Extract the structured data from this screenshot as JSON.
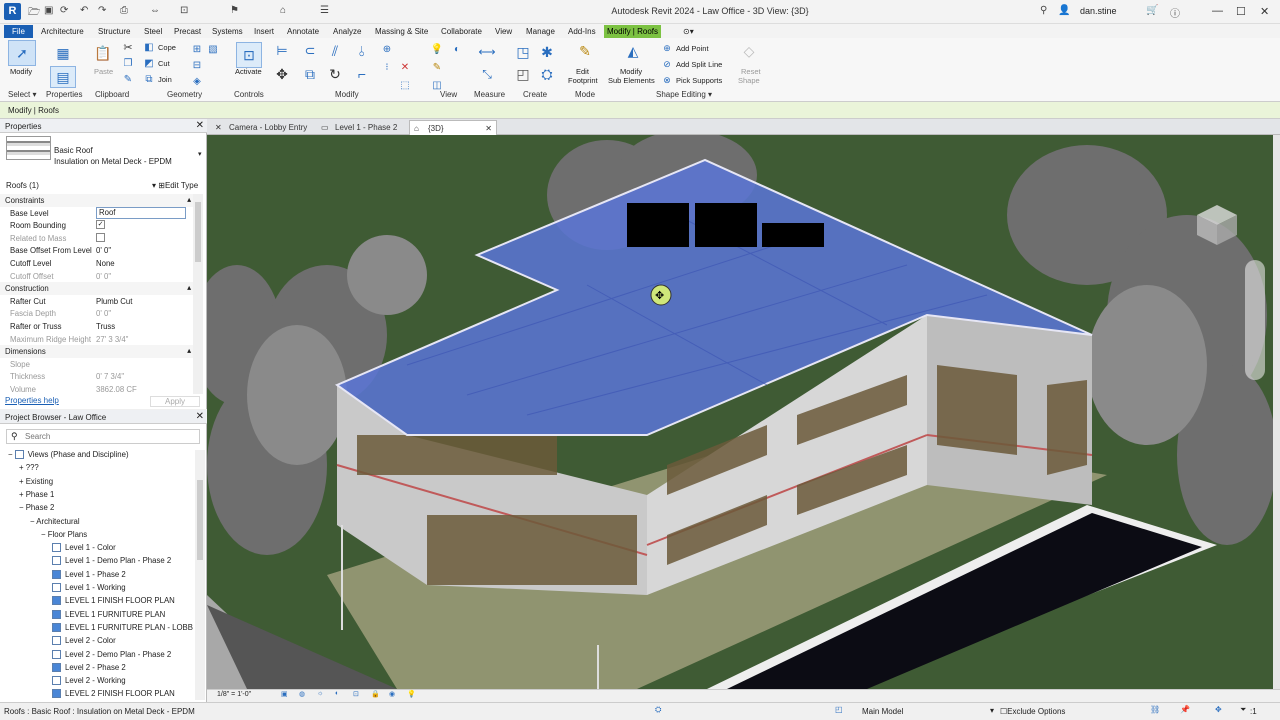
{
  "app": {
    "icon_letter": "R",
    "title": "Autodesk Revit 2024 - Law Office - 3D View: {3D}",
    "user": "dan.stine"
  },
  "ribbon_tabs": [
    "File",
    "Architecture",
    "Structure",
    "Steel",
    "Precast",
    "Systems",
    "Insert",
    "Annotate",
    "Analyze",
    "Massing & Site",
    "Collaborate",
    "View",
    "Manage",
    "Add-Ins",
    "Modify | Roofs"
  ],
  "ribbon": {
    "modify": "Modify",
    "paste": "Paste",
    "cope": "Cope",
    "cut": "Cut",
    "join": "Join",
    "activate": "Activate",
    "edit_footprint": [
      "Edit",
      "Footprint"
    ],
    "modify_sub": [
      "Modify",
      "Sub Elements"
    ],
    "add_point": "Add Point",
    "add_split_line": "Add Split Line",
    "pick_supports": "Pick Supports",
    "reset_shape": [
      "Reset",
      "Shape"
    ],
    "groups": {
      "select": "Select",
      "properties": "Properties",
      "clipboard": "Clipboard",
      "geometry": "Geometry",
      "controls": "Controls",
      "modify": "Modify",
      "view": "View",
      "measure": "Measure",
      "create": "Create",
      "mode": "Mode",
      "shape_editing": "Shape Editing"
    }
  },
  "options_bar": "Modify | Roofs",
  "properties": {
    "title": "Properties",
    "type_name": "Basic Roof",
    "type_sub": "Insulation on Metal Deck - EPDM",
    "selector": "Roofs (1)",
    "edit_type": "Edit Type",
    "rows": [
      {
        "k": "Constraints",
        "v": "",
        "cat": true
      },
      {
        "k": "Base Level",
        "v": "Roof",
        "input": true
      },
      {
        "k": "Room Bounding",
        "v": "✓",
        "check": true
      },
      {
        "k": "Related to Mass",
        "v": "",
        "gray": true,
        "check": true
      },
      {
        "k": "Base Offset From Level",
        "v": "0'  0\""
      },
      {
        "k": "Cutoff Level",
        "v": "None"
      },
      {
        "k": "Cutoff Offset",
        "v": "0'  0\"",
        "gray": true
      },
      {
        "k": "Construction",
        "v": "",
        "cat": true
      },
      {
        "k": "Rafter Cut",
        "v": "Plumb Cut"
      },
      {
        "k": "Fascia Depth",
        "v": "0'  0\"",
        "gray": true
      },
      {
        "k": "Rafter or Truss",
        "v": "Truss"
      },
      {
        "k": "Maximum Ridge Height",
        "v": "27'  3 3/4\"",
        "gray": true
      },
      {
        "k": "Dimensions",
        "v": "",
        "cat": true
      },
      {
        "k": "Slope",
        "v": "",
        "gray": true
      },
      {
        "k": "Thickness",
        "v": "0'  7 3/4\"",
        "gray": true
      },
      {
        "k": "Volume",
        "v": "3862.08 CF",
        "gray": true
      }
    ],
    "help": "Properties help",
    "apply": "Apply"
  },
  "browser": {
    "title": "Project Browser - Law Office",
    "search_placeholder": "Search",
    "items": [
      {
        "label": "Views (Phase and Discipline)",
        "lvl": 0,
        "exp": "−"
      },
      {
        "label": "???",
        "lvl": 1,
        "exp": "+"
      },
      {
        "label": "Existing",
        "lvl": 1,
        "exp": "+"
      },
      {
        "label": "Phase 1",
        "lvl": 1,
        "exp": "+"
      },
      {
        "label": "Phase 2",
        "lvl": 1,
        "exp": "−"
      },
      {
        "label": "Architectural",
        "lvl": 2,
        "exp": "−"
      },
      {
        "label": "Floor Plans",
        "lvl": 3,
        "exp": "−"
      },
      {
        "label": "Level 1 - Color",
        "lvl": 4,
        "view": true
      },
      {
        "label": "Level 1 - Demo Plan - Phase 2",
        "lvl": 4,
        "view": true
      },
      {
        "label": "Level 1 - Phase 2",
        "lvl": 4,
        "view": true,
        "sel": true
      },
      {
        "label": "Level 1 - Working",
        "lvl": 4,
        "view": true
      },
      {
        "label": "LEVEL 1 FINISH FLOOR PLAN",
        "lvl": 4,
        "view": true,
        "sel": true
      },
      {
        "label": "LEVEL 1 FURNITURE PLAN",
        "lvl": 4,
        "view": true,
        "sel": true
      },
      {
        "label": "LEVEL 1 FURNITURE PLAN - LOBB",
        "lvl": 4,
        "view": true,
        "sel": true
      },
      {
        "label": "Level 2 - Color",
        "lvl": 4,
        "view": true
      },
      {
        "label": "Level 2 - Demo Plan - Phase 2",
        "lvl": 4,
        "view": true
      },
      {
        "label": "Level 2 - Phase 2",
        "lvl": 4,
        "view": true,
        "sel": true
      },
      {
        "label": "Level 2 - Working",
        "lvl": 4,
        "view": true
      },
      {
        "label": "LEVEL 2 FINISH FLOOR PLAN",
        "lvl": 4,
        "view": true,
        "sel": true
      }
    ]
  },
  "view_tabs": [
    "Camera - Lobby Entry",
    "Level 1 - Phase 2",
    "{3D}"
  ],
  "view_control": {
    "scale": "1/8\" = 1'-0\""
  },
  "status": {
    "left": "Roofs : Basic Roof : Insulation on Metal Deck - EPDM",
    "model": "Main Model",
    "exclude": "Exclude Options",
    "filter": ":1"
  }
}
